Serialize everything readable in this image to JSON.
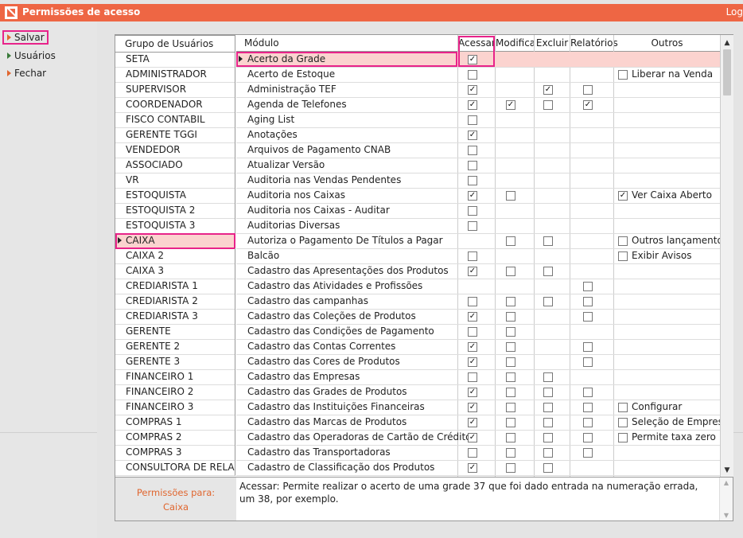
{
  "app": {
    "title": "Permissões de acesso",
    "logout_label": "Log"
  },
  "sidebar": {
    "items": [
      {
        "label": "Salvar",
        "icon": "orange-triangle-icon"
      },
      {
        "label": "Usuários",
        "icon": "green-triangle-icon"
      },
      {
        "label": "Fechar",
        "icon": "orange-triangle-icon"
      }
    ]
  },
  "groups": {
    "header": "Grupo de Usuários",
    "items": [
      "SETA",
      "ADMINISTRADOR",
      "SUPERVISOR",
      "COORDENADOR",
      "FISCO CONTABIL",
      "GERENTE TGGI",
      "VENDEDOR",
      "ASSOCIADO",
      "VR",
      "ESTOQUISTA",
      "ESTOQUISTA 2",
      "ESTOQUISTA 3",
      "CAIXA",
      "CAIXA 2",
      "CAIXA 3",
      "CREDIARISTA 1",
      "CREDIARISTA 2",
      "CREDIARISTA 3",
      "GERENTE",
      "GERENTE 2",
      "GERENTE 3",
      "FINANCEIRO 1",
      "FINANCEIRO 2",
      "FINANCEIRO 3",
      "COMPRAS 1",
      "COMPRAS 2",
      "COMPRAS 3",
      "CONSULTORA DE RELACIONAMENTO"
    ],
    "selected": "CAIXA"
  },
  "permissions_for": {
    "label": "Permissões para:",
    "value": "Caixa"
  },
  "table": {
    "headers": {
      "module": "Módulo",
      "access": "Acessar",
      "modify": "Modifica",
      "delete": "Excluir",
      "reports": "Relatórios",
      "others": "Outros"
    },
    "selected_module": "Acerto da Grade",
    "rows": [
      {
        "module": "Acerto da Grade",
        "access": true,
        "modify": null,
        "delete": null,
        "reports": null,
        "others": []
      },
      {
        "module": "Acerto de Estoque",
        "access": false,
        "modify": null,
        "delete": null,
        "reports": null,
        "others": [
          {
            "label": "Liberar na Venda",
            "checked": false
          }
        ]
      },
      {
        "module": "Administração TEF",
        "access": true,
        "modify": null,
        "delete": true,
        "reports": false,
        "others": []
      },
      {
        "module": "Agenda de Telefones",
        "access": true,
        "modify": true,
        "delete": false,
        "reports": true,
        "others": []
      },
      {
        "module": "Aging List",
        "access": false,
        "modify": null,
        "delete": null,
        "reports": null,
        "others": []
      },
      {
        "module": "Anotações",
        "access": true,
        "modify": null,
        "delete": null,
        "reports": null,
        "others": []
      },
      {
        "module": "Arquivos de Pagamento CNAB",
        "access": false,
        "modify": null,
        "delete": null,
        "reports": null,
        "others": []
      },
      {
        "module": "Atualizar Versão",
        "access": false,
        "modify": null,
        "delete": null,
        "reports": null,
        "others": []
      },
      {
        "module": "Auditoria nas Vendas Pendentes",
        "access": false,
        "modify": null,
        "delete": null,
        "reports": null,
        "others": []
      },
      {
        "module": "Auditoria nos Caixas",
        "access": true,
        "modify": false,
        "delete": null,
        "reports": null,
        "others": [
          {
            "label": "Ver Caixa Aberto",
            "checked": true
          }
        ]
      },
      {
        "module": "Auditoria nos Caixas - Auditar",
        "access": false,
        "modify": null,
        "delete": null,
        "reports": null,
        "others": []
      },
      {
        "module": "Auditorias Diversas",
        "access": false,
        "modify": null,
        "delete": null,
        "reports": null,
        "others": []
      },
      {
        "module": "Autoriza o Pagamento De Títulos a Pagar",
        "access": null,
        "modify": false,
        "delete": false,
        "reports": null,
        "others": [
          {
            "label": "Outros lançamentos",
            "checked": false
          }
        ]
      },
      {
        "module": "Balcão",
        "access": false,
        "modify": null,
        "delete": null,
        "reports": null,
        "others": [
          {
            "label": "Exibir Avisos",
            "checked": false
          }
        ]
      },
      {
        "module": "Cadastro das Apresentações dos Produtos",
        "access": true,
        "modify": false,
        "delete": false,
        "reports": null,
        "others": []
      },
      {
        "module": "Cadastro das Atividades e Profissões",
        "access": null,
        "modify": null,
        "delete": null,
        "reports": false,
        "others": []
      },
      {
        "module": "Cadastro das campanhas",
        "access": false,
        "modify": false,
        "delete": false,
        "reports": false,
        "others": []
      },
      {
        "module": "Cadastro das Coleções de Produtos",
        "access": true,
        "modify": false,
        "delete": null,
        "reports": false,
        "others": []
      },
      {
        "module": "Cadastro das Condições de Pagamento",
        "access": false,
        "modify": false,
        "delete": null,
        "reports": null,
        "others": []
      },
      {
        "module": "Cadastro das Contas Correntes",
        "access": true,
        "modify": false,
        "delete": null,
        "reports": false,
        "others": []
      },
      {
        "module": "Cadastro das Cores de Produtos",
        "access": true,
        "modify": false,
        "delete": null,
        "reports": false,
        "others": []
      },
      {
        "module": "Cadastro das Empresas",
        "access": false,
        "modify": false,
        "delete": false,
        "reports": null,
        "others": []
      },
      {
        "module": "Cadastro das Grades de Produtos",
        "access": true,
        "modify": false,
        "delete": false,
        "reports": false,
        "others": []
      },
      {
        "module": "Cadastro das Instituições Financeiras",
        "access": true,
        "modify": false,
        "delete": false,
        "reports": false,
        "others": [
          {
            "label": "Configurar",
            "checked": false
          }
        ]
      },
      {
        "module": "Cadastro das Marcas de Produtos",
        "access": true,
        "modify": false,
        "delete": false,
        "reports": false,
        "others": [
          {
            "label": "Seleção de Empresas",
            "checked": false
          }
        ]
      },
      {
        "module": "Cadastro das Operadoras de Cartão de Crédito",
        "access": true,
        "modify": false,
        "delete": false,
        "reports": false,
        "others": [
          {
            "label": "Permite taxa zero",
            "checked": false
          }
        ]
      },
      {
        "module": "Cadastro das Transportadoras",
        "access": false,
        "modify": false,
        "delete": false,
        "reports": false,
        "others": []
      },
      {
        "module": "Cadastro de Classificação dos Produtos",
        "access": true,
        "modify": false,
        "delete": false,
        "reports": null,
        "others": []
      }
    ]
  },
  "description": "Acessar: Permite realizar o acerto de uma grade 37 que foi dado entrada na numeração errada, um 38, por exemplo.",
  "colors": {
    "accent": "#ee6644",
    "selected_row": "#fbd3cf",
    "highlight": "#e8238a"
  }
}
